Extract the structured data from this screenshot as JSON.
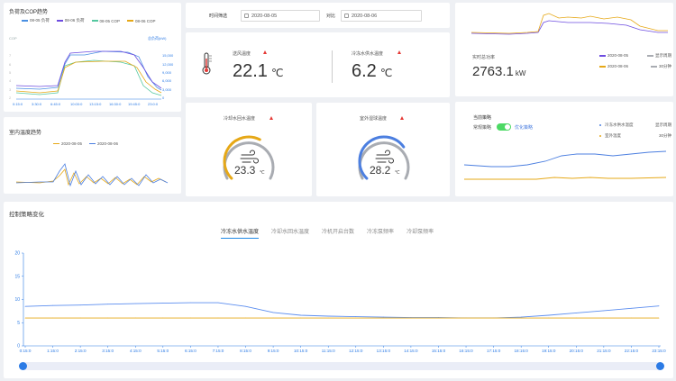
{
  "colors": {
    "blue": "#4c7fe0",
    "orange": "#e6a817",
    "purple": "#6d4ce0",
    "green": "#55c8a0",
    "grey": "#a9acb2",
    "red": "#e53935"
  },
  "load_cop": {
    "title": "负荷及COP趋势",
    "legend": [
      {
        "label": "08-05 负荷",
        "color": "#4a90e2"
      },
      {
        "label": "08-06 负荷",
        "color": "#6d4ce0"
      },
      {
        "label": "08-05 COP",
        "color": "#55c8a0"
      },
      {
        "label": "08-06 COP",
        "color": "#e6a817"
      }
    ],
    "left_axis_label": "COP",
    "right_axis_label": "总负荷(kW)",
    "right_ticks": [
      "15,000",
      "12,000",
      "9,000",
      "6,000",
      "3,000",
      "0"
    ],
    "x_ticks": [
      "0:15:0",
      "3:30:0",
      "6:45:0",
      "10:00:0",
      "13:15:0",
      "16:30:0",
      "19:45:0",
      "23:0:0"
    ]
  },
  "filter": {
    "time_label": "时间筛选",
    "date1": "2020-08-05",
    "compare_label": "对比",
    "date2": "2020-08-06"
  },
  "supply": {
    "title": "送风温度",
    "value": "22.1",
    "unit": "℃",
    "chw_title": "冷冻水供水温度",
    "chw_value": "6.2",
    "chw_unit": "℃"
  },
  "power": {
    "label": "实时总功率",
    "value": "2763.1",
    "unit": "kW",
    "legend": [
      {
        "label": "2020-08-05",
        "color": "#6d4ce0"
      },
      {
        "label": "显示周期",
        "color": "#a9acb2"
      },
      {
        "label": "2020-08-06",
        "color": "#e6a817"
      },
      {
        "label": "30分钟",
        "color": "#a9acb2"
      }
    ]
  },
  "indoor": {
    "title": "室内温度趋势",
    "legend": [
      {
        "label": "2020-08-05",
        "color": "#e6a817"
      },
      {
        "label": "2020-08-06",
        "color": "#4c7fe0"
      }
    ]
  },
  "cooling_return": {
    "title": "冷却水回水温度",
    "value": "23.3",
    "unit": "℃",
    "fraction": 0.6
  },
  "outdoor": {
    "title": "室外湿球温度",
    "value": "28.2",
    "unit": "℃",
    "fraction": 0.7
  },
  "strategy": {
    "title": "当前策略",
    "normal": "常规策略",
    "optimized": "优化策略",
    "legend": [
      {
        "label": "冷冻水供水温度",
        "color": "#4c7fe0"
      },
      {
        "label": "显示周期",
        "color": "#a9acb2"
      },
      {
        "label": "室外温度",
        "color": "#e6a817"
      },
      {
        "label": "30分钟",
        "color": "#a9acb2"
      }
    ]
  },
  "control": {
    "title": "控制策略变化",
    "tabs": [
      "冷冻水供水温度",
      "冷却水回水温度",
      "冷机开启台数",
      "冷冻泵频率",
      "冷却泵频率"
    ],
    "active_tab": 0
  },
  "chart_data": {
    "type": "line",
    "title": "",
    "ylim": [
      0,
      20
    ],
    "y_ticks": [
      0,
      5,
      10,
      15,
      20
    ],
    "x": [
      "0:15:0",
      "1:15:0",
      "2:15:0",
      "3:15:0",
      "4:15:0",
      "5:15:0",
      "6:15:0",
      "7:15:0",
      "8:15:0",
      "9:15:0",
      "10:15:0",
      "11:15:0",
      "12:15:0",
      "13:15:0",
      "14:15:0",
      "15:15:0",
      "16:15:0",
      "17:15:0",
      "18:15:0",
      "19:15:0",
      "20:15:0",
      "21:15:0",
      "22:15:0",
      "23:15:0"
    ],
    "series": [
      {
        "color": "#5b8def",
        "values": [
          8.5,
          8.7,
          8.8,
          9.0,
          9.1,
          9.2,
          9.3,
          9.3,
          8.5,
          7.2,
          6.6,
          6.4,
          6.3,
          6.2,
          6.1,
          6.1,
          6.0,
          6.0,
          6.2,
          6.6,
          7.1,
          7.6,
          8.1,
          8.6
        ]
      },
      {
        "color": "#e6a817",
        "values": [
          6,
          6,
          6,
          6,
          6,
          6,
          6,
          6,
          6,
          6,
          6,
          6,
          6,
          6,
          6,
          6,
          6,
          6,
          6,
          6,
          6,
          6,
          6,
          6
        ]
      }
    ],
    "grid": false
  }
}
